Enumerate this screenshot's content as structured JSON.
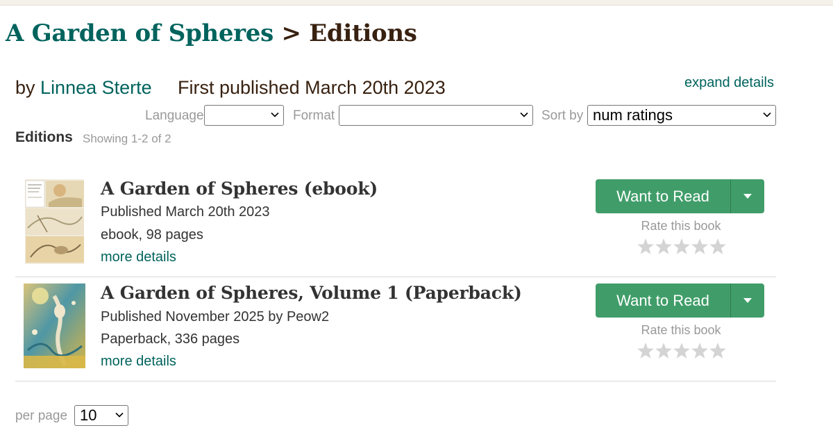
{
  "header": {
    "book_title": "A Garden of Spheres",
    "separator": ">",
    "section": "Editions"
  },
  "byline": {
    "by": "by",
    "author": "Linnea Sterte",
    "first_published": "First published March 20th 2023",
    "expand_details": "expand details"
  },
  "filters": {
    "language_label": "Language",
    "language_value": "",
    "format_label": "Format",
    "format_value": "",
    "sort_label": "Sort by",
    "sort_value": "num ratings"
  },
  "editions": {
    "heading": "Editions",
    "showing": "Showing 1-2 of 2",
    "items": [
      {
        "title": "A Garden of Spheres (ebook)",
        "published": "Published March 20th 2023",
        "format": "ebook, 98 pages",
        "more": "more details",
        "button": "Want to Read",
        "rate": "Rate this book",
        "stars": 0
      },
      {
        "title": "A Garden of Spheres, Volume 1 (Paperback)",
        "published": "Published November 2025 by Peow2",
        "format": "Paperback, 336 pages",
        "more": "more details",
        "button": "Want to Read",
        "rate": "Rate this book",
        "stars": 0
      }
    ]
  },
  "pagination": {
    "per_page_label": "per page",
    "per_page_value": "10"
  },
  "colors": {
    "title_brown": "#382110",
    "link_teal": "#00635d",
    "button_green": "#409d69",
    "star_gray": "#d4d4d4",
    "muted_gray": "#999999"
  },
  "icons": {
    "dropdown": "chevron-down-icon",
    "star": "star-icon",
    "button_caret": "caret-down-icon"
  }
}
